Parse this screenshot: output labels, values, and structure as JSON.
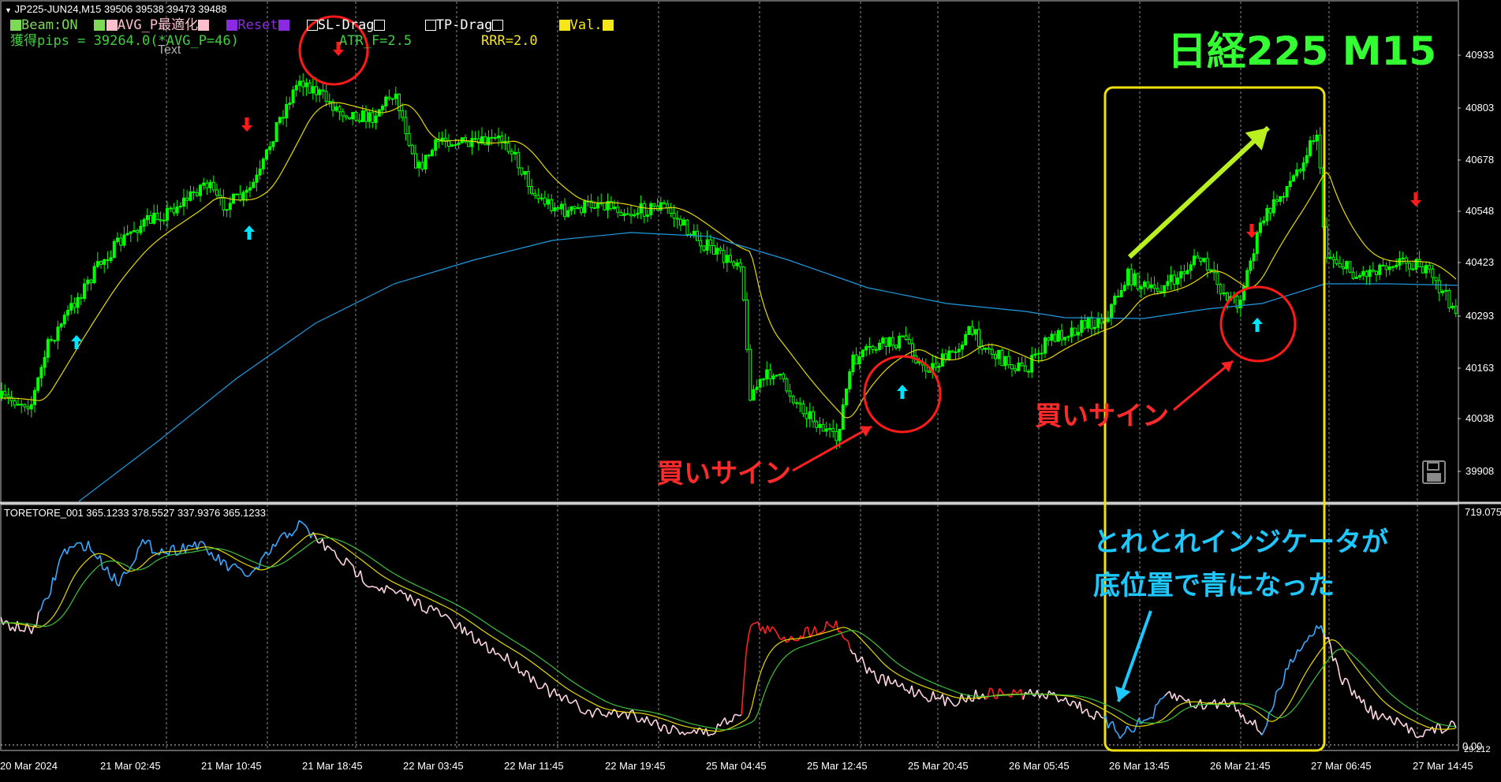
{
  "window": {
    "symbol_line": "JP225-JUN24,M15  39506 39538 39473 39488",
    "sub_symbol_line": "TORETORE_001 365.1233 378.5527 337.9376 365.1233"
  },
  "controls": {
    "beam": "Beam:ON",
    "avg_p": "AVG_P最適化",
    "reset": "Reset",
    "sl_drag": "SL-Drag",
    "tp_drag": "TP-Drag",
    "val": "Val.",
    "pips_line": "獲得pips = 39264.0(*AVG_P=46)",
    "atr": "ATR_F=2.5",
    "rrr": "RRR=2.0",
    "text_label": "Text"
  },
  "annotations": {
    "title": "日経225  M15",
    "buy_sign_1": "買いサイン",
    "buy_sign_2": "買いサイン",
    "indicator_note_1": "とれとれインジケータが",
    "indicator_note_2": "底位置で青になった"
  },
  "price_axis": [
    "40933",
    "40803",
    "40678",
    "40548",
    "40423",
    "40293",
    "40163",
    "40038",
    "39908"
  ],
  "sub_axis": {
    "top": "719.075",
    "bottom": "0.00",
    "mid": "29.212"
  },
  "time_axis": [
    "20 Mar 2024",
    "21 Mar 02:45",
    "21 Mar 10:45",
    "21 Mar 18:45",
    "22 Mar 03:45",
    "22 Mar 11:45",
    "22 Mar 19:45",
    "25 Mar 04:45",
    "25 Mar 12:45",
    "25 Mar 20:45",
    "26 Mar 05:45",
    "26 Mar 13:45",
    "26 Mar 21:45",
    "27 Mar 06:45",
    "27 Mar 14:45"
  ],
  "colors": {
    "bull_candle": "#00ff00",
    "ma_fast": "#e6d800",
    "ma_slow": "#1e9be0",
    "buy_arrow": "#00e5ff",
    "sell_arrow": "#ff1a1a",
    "osc_blue": "#3aa8ff",
    "osc_pink": "#ffd6e0",
    "osc_red": "#ff2020",
    "osc_green": "#3cc23c",
    "highlight_box": "#f0e010",
    "title_green": "#33ff33",
    "annotation_red": "#ff2a2a",
    "annotation_cyan": "#1ec8ff"
  }
}
